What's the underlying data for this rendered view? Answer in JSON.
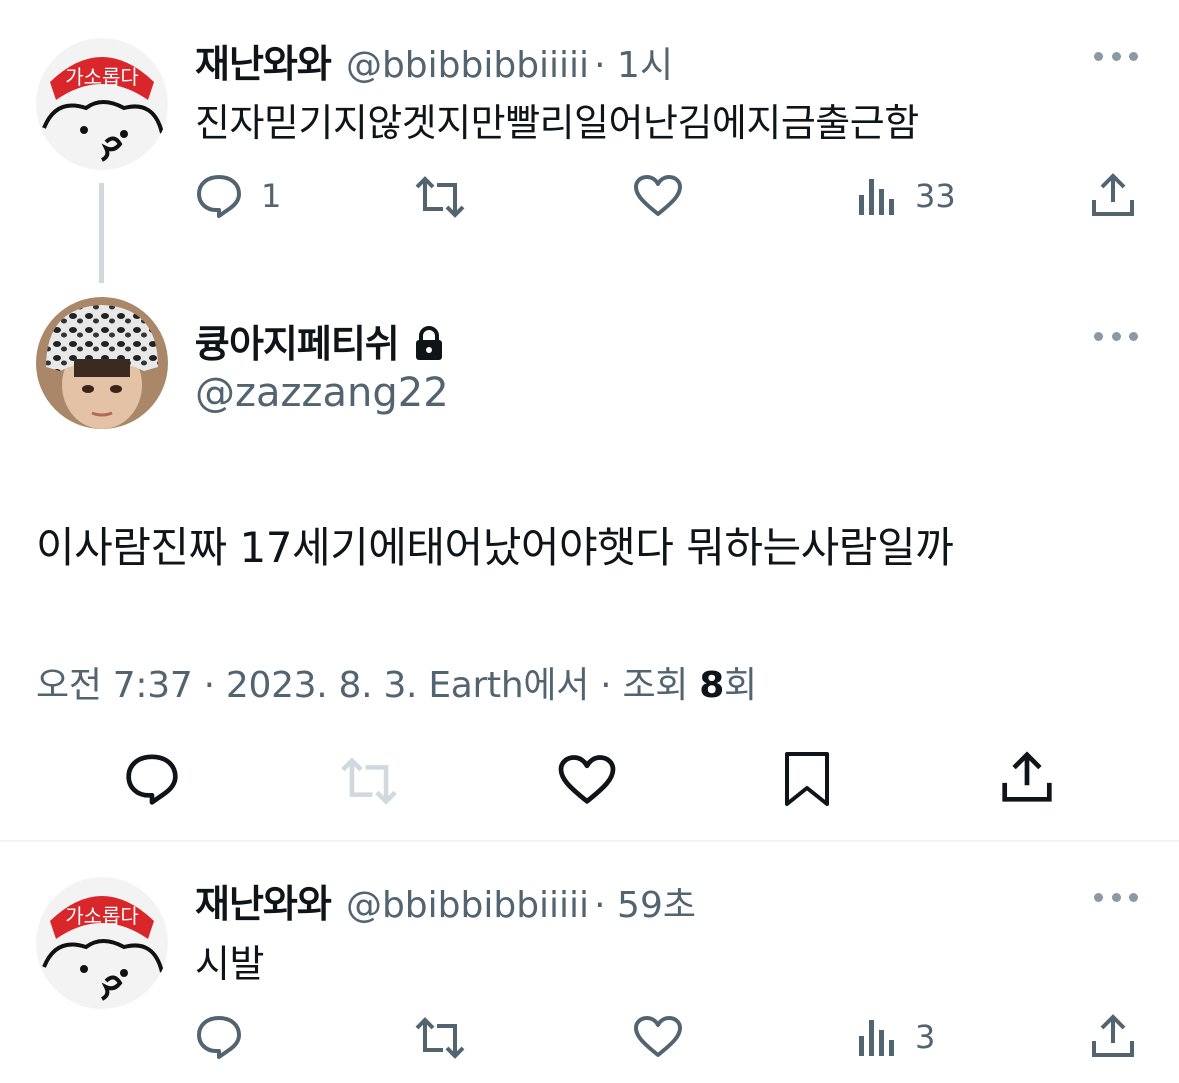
{
  "tweet1": {
    "display_name": "재난와와",
    "handle": "@bbibbibbiiiii",
    "time": "· 1시",
    "text": "진자믿기지않겟지만빨리일어난김에지금출근함",
    "avatar_badge": "가소롭다",
    "replies": "1",
    "views": "33"
  },
  "main_tweet": {
    "display_name": "큥아지페티쉬",
    "handle": "@zazzang22",
    "text": "이사람진짜 17세기에태어났어야햇다 뭐하는사람일까",
    "meta_prefix": "오전 7:37 · 2023. 8. 3. Earth에서 · 조회 ",
    "view_count": "8",
    "meta_suffix": "회"
  },
  "tweet3": {
    "display_name": "재난와와",
    "handle": "@bbibbibbiiiii",
    "time": "· 59초",
    "text": "시발",
    "avatar_badge": "가소롭다",
    "views": "3"
  },
  "icons": [
    "reply-icon",
    "retweet-icon",
    "like-icon",
    "views-icon",
    "share-icon",
    "bookmark-icon",
    "lock-icon",
    "more-icon"
  ],
  "colors": {
    "text": "#0f1419",
    "secondary": "#536471",
    "badge": "#d8262a",
    "divider": "#eff3f4"
  }
}
